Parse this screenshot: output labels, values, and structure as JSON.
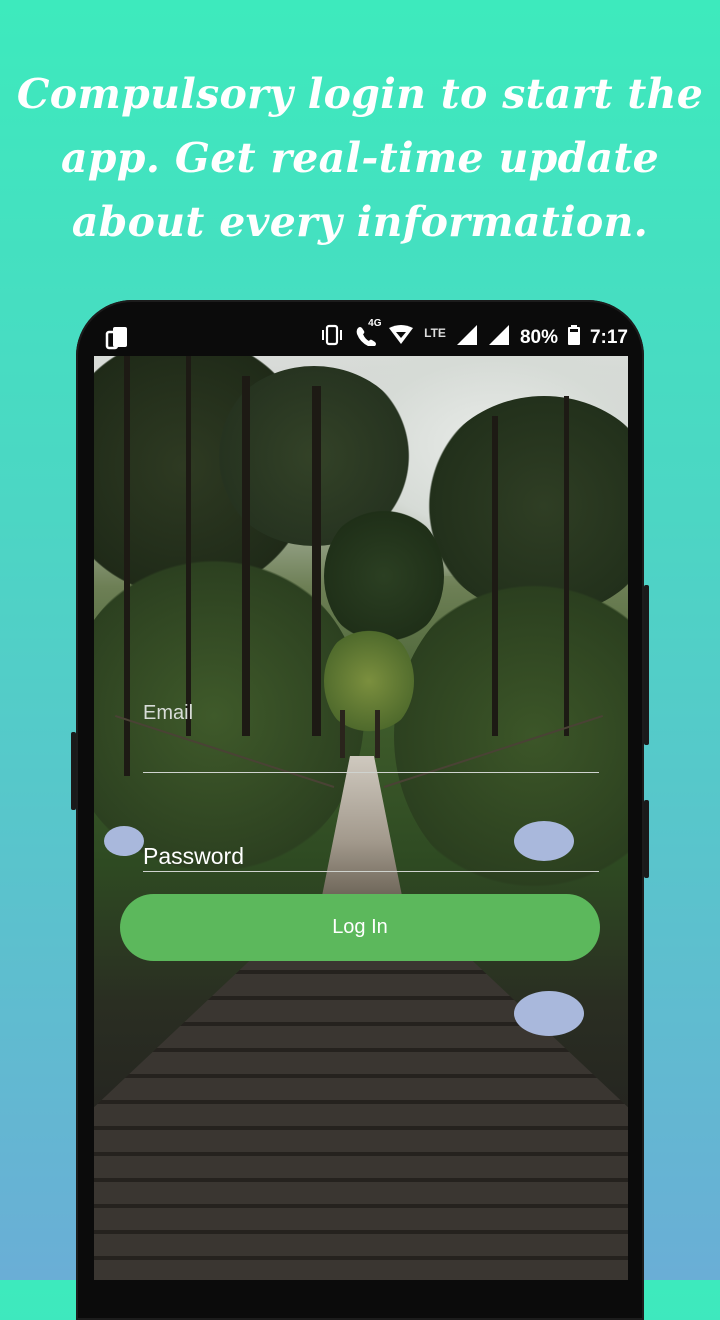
{
  "headline": {
    "line1": "Compulsory login to start the",
    "line2": "app. Get real-time update",
    "line3": "about every information."
  },
  "status_bar": {
    "network_label": "LTE",
    "net_4g": "4G",
    "battery": "80%",
    "time": "7:17"
  },
  "login": {
    "email_placeholder": "Email",
    "password_placeholder": "Password",
    "login_label": "Log In"
  },
  "colors": {
    "bg_top": "#3deabd",
    "bg_bottom": "#6aaed6",
    "button": "#5cb85c"
  }
}
